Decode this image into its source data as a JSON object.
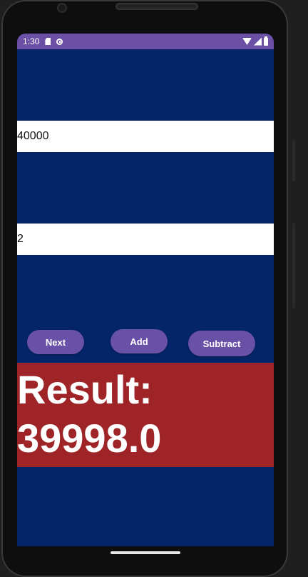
{
  "status_bar": {
    "time": "1:30",
    "icons_left": [
      "sd-card-icon",
      "sync-icon"
    ],
    "icons_right": [
      "wifi-icon",
      "signal-icon",
      "battery-icon"
    ],
    "color": "#6b50a6"
  },
  "inputs": {
    "first_value": "40000",
    "second_value": "2"
  },
  "buttons": {
    "next_label": "Next",
    "add_label": "Add",
    "subtract_label": "Subtract",
    "color": "#6a51a8"
  },
  "result": {
    "text": "Result:\n39998.0",
    "background": "#9e2428"
  },
  "colors": {
    "screen_background": "#04256a",
    "field_background": "#ffffff"
  }
}
